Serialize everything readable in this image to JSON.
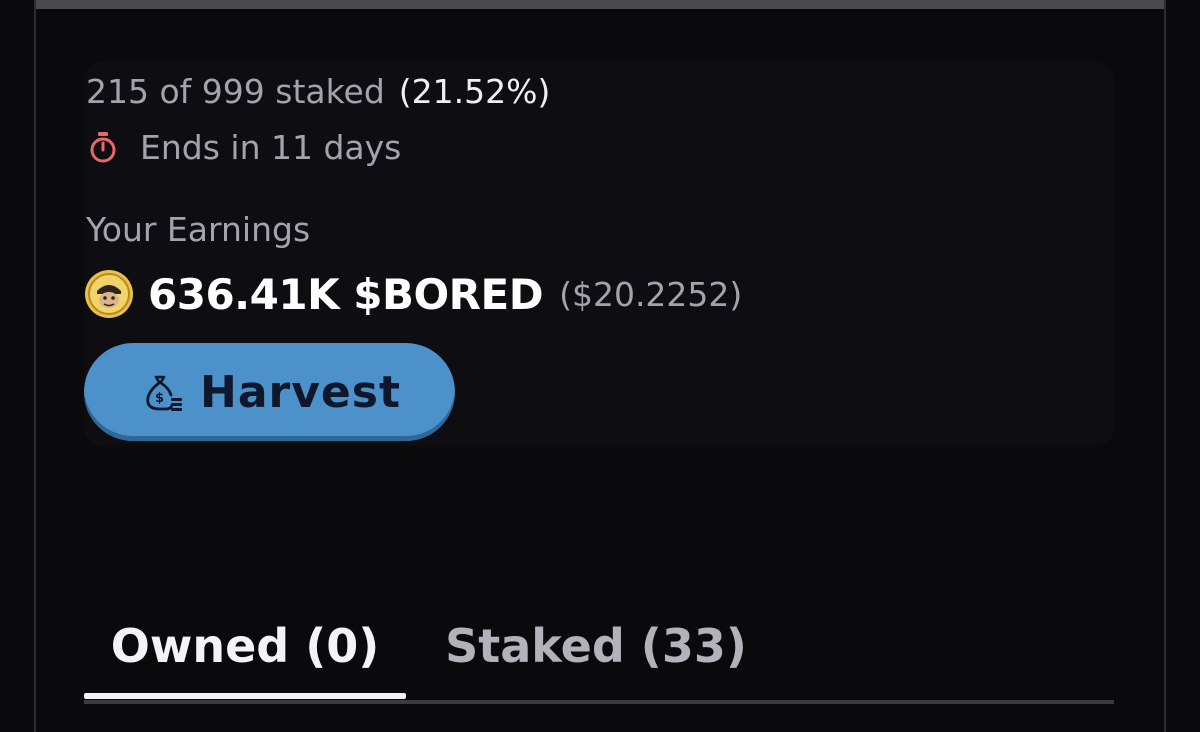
{
  "staking": {
    "staked_text": "215 of 999 staked",
    "staked_percent": "(21.52%)",
    "ends_text": "Ends in 11 days",
    "timer_icon": "stopwatch-icon"
  },
  "earnings": {
    "label": "Your Earnings",
    "amount": "636.41K $BORED",
    "usd_value": "($20.2252)",
    "token_icon": "bored-token-coin-icon"
  },
  "actions": {
    "harvest_label": "Harvest",
    "harvest_icon": "money-bag-icon",
    "harvest_color": "#4c91c9"
  },
  "tabs": [
    {
      "label": "Owned (0)",
      "active": true
    },
    {
      "label": "Staked (33)",
      "active": false
    }
  ],
  "colors": {
    "background": "#0a090c",
    "muted_text": "#a4a3ad",
    "timer_accent": "#e46a66"
  }
}
